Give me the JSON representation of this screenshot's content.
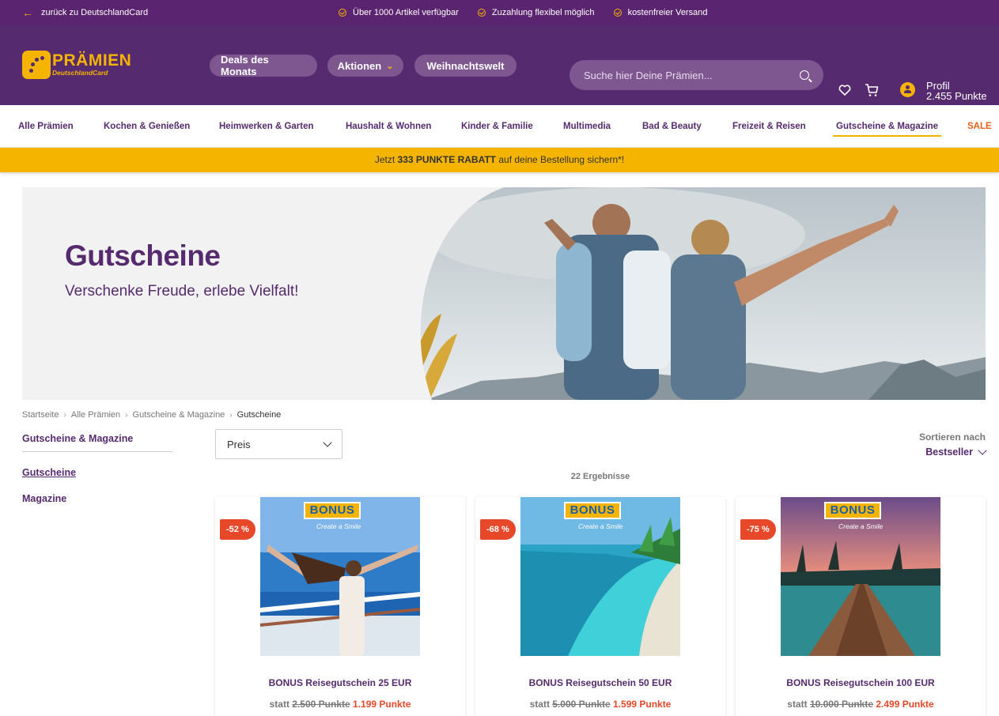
{
  "topbar": {
    "back_label": "zurück zu DeutschlandCard",
    "usps": [
      "Über 1000 Artikel verfügbar",
      "Zuzahlung flexibel möglich",
      "kostenfreier Versand"
    ]
  },
  "header": {
    "logo_title": "PRÄMIEN",
    "logo_subtitle": "DeutschlandCard",
    "pills": [
      "Deals des Monats",
      "Aktionen",
      "Weihnachtswelt"
    ],
    "search_placeholder": "Suche hier Deine Prämien...",
    "profile_label": "Profil",
    "profile_points": "2.455 Punkte"
  },
  "categories": [
    "Alle Prämien",
    "Kochen & Genießen",
    "Heimwerken & Garten",
    "Haushalt & Wohnen",
    "Kinder & Familie",
    "Multimedia",
    "Bad & Beauty",
    "Freizeit & Reisen",
    "Gutscheine & Magazine",
    "SALE"
  ],
  "promo": {
    "prefix": "Jetzt ",
    "highlight": "333 PUNKTE RABATT",
    "suffix": " auf deine Bestellung sichern*!"
  },
  "hero": {
    "title": "Gutscheine",
    "subtitle": "Verschenke Freude, erlebe Vielfalt!"
  },
  "breadcrumb": [
    "Startseite",
    "Alle Prämien",
    "Gutscheine & Magazine",
    "Gutscheine"
  ],
  "sidebar": {
    "heading": "Gutscheine & Magazine",
    "links": [
      "Gutscheine",
      "Magazine"
    ]
  },
  "filter": {
    "label": "Preis"
  },
  "sort": {
    "label": "Sortieren nach",
    "value": "Bestseller"
  },
  "results": "22 Ergebnisse",
  "products": [
    {
      "name": "BONUS Reisegutschein 25 EUR",
      "badge": "-52 %",
      "statt": "statt",
      "old": "2.500 Punkte",
      "new": "1.199 Punkte"
    },
    {
      "name": "BONUS Reisegutschein 50 EUR",
      "badge": "-68 %",
      "statt": "statt",
      "old": "5.000 Punkte",
      "new": "1.599 Punkte"
    },
    {
      "name": "BONUS Reisegutschein 100 EUR",
      "badge": "-75 %",
      "statt": "statt",
      "old": "10.000 Punkte",
      "new": "2.499 Punkte"
    }
  ],
  "brand": {
    "logo_text": "BONUS",
    "tagline": "Create a Smile"
  },
  "colors": {
    "purple": "#562a6e",
    "yellow": "#f4b400",
    "red": "#e8482a"
  }
}
